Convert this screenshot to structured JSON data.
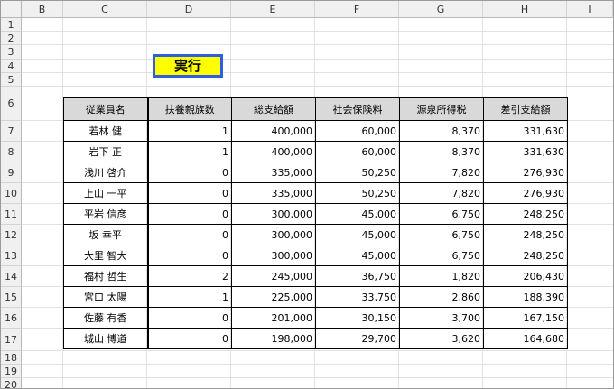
{
  "columns": [
    "B",
    "C",
    "D",
    "E",
    "F",
    "G",
    "H",
    "I"
  ],
  "rows": [
    "1",
    "2",
    "3",
    "4",
    "5",
    "6",
    "7",
    "8",
    "9",
    "10",
    "11",
    "12",
    "13",
    "14",
    "15",
    "16",
    "17",
    "18",
    "19",
    "20"
  ],
  "run_button": {
    "label": "実行"
  },
  "table": {
    "headers": [
      "従業員名",
      "扶養親族数",
      "総支給額",
      "社会保険料",
      "源泉所得税",
      "差引支給額"
    ],
    "rows": [
      [
        "若林 健",
        "1",
        "400,000",
        "60,000",
        "8,370",
        "331,630"
      ],
      [
        "岩下 正",
        "1",
        "400,000",
        "60,000",
        "8,370",
        "331,630"
      ],
      [
        "浅川 啓介",
        "0",
        "335,000",
        "50,250",
        "7,820",
        "276,930"
      ],
      [
        "上山 一平",
        "0",
        "335,000",
        "50,250",
        "7,820",
        "276,930"
      ],
      [
        "平岩 信彦",
        "0",
        "300,000",
        "45,000",
        "6,750",
        "248,250"
      ],
      [
        "坂 幸平",
        "0",
        "300,000",
        "45,000",
        "6,750",
        "248,250"
      ],
      [
        "大里 智大",
        "0",
        "300,000",
        "45,000",
        "6,750",
        "248,250"
      ],
      [
        "福村 哲生",
        "2",
        "245,000",
        "36,750",
        "1,820",
        "206,430"
      ],
      [
        "宮口 太陽",
        "1",
        "225,000",
        "33,750",
        "2,860",
        "188,390"
      ],
      [
        "佐藤 有香",
        "0",
        "201,000",
        "30,150",
        "3,700",
        "167,150"
      ],
      [
        "城山 博道",
        "0",
        "198,000",
        "29,700",
        "3,620",
        "164,680"
      ]
    ]
  }
}
